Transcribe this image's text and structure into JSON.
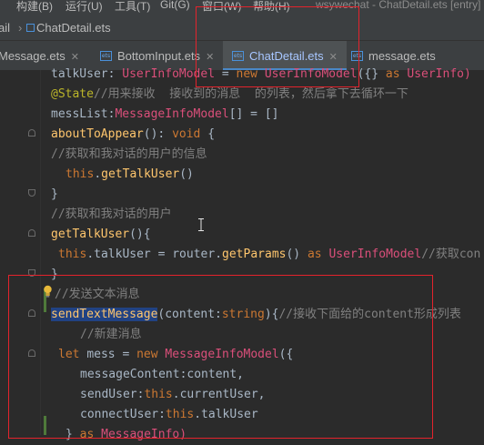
{
  "menubar": {
    "items": [
      "il",
      "构建(B)",
      "运行(U)",
      "工具(T)",
      "Git(G)",
      "窗口(W)",
      "帮助(H)"
    ],
    "window_title": "wsywechat - ChatDetail.ets [entry]"
  },
  "breadcrumb": {
    "prev": "ail",
    "file": "ChatDetail.ets"
  },
  "tabs": [
    {
      "label": "Message.ets",
      "active": false
    },
    {
      "label": "BottomInput.ets",
      "active": false
    },
    {
      "label": "ChatDetail.ets",
      "active": true
    },
    {
      "label": "message.ets",
      "active": false
    }
  ],
  "code": {
    "l1": {
      "a": "talkUser",
      "b": ": ",
      "c": "UserInfoModel",
      "d": " = ",
      "e": "new ",
      "f": "UserInfoModel",
      "g": "({} ",
      "h": "as ",
      "i": "UserInfo)"
    },
    "l2": {
      "a": "@State",
      "b": "//用来接收  接收到的消息  的列表，然后拿下去循环一下"
    },
    "l3": {
      "a": "messList",
      "b": ":",
      "c": "MessageInfoModel",
      "d": "[] = []"
    },
    "l4": {
      "a": "aboutToAppear",
      "b": "(): ",
      "c": "void",
      "d": " {"
    },
    "l5": {
      "a": "//获取和我对话的用户的信息"
    },
    "l6": {
      "a": "this",
      "b": ".",
      "c": "getTalkUser",
      "d": "()"
    },
    "l7": {
      "a": "}"
    },
    "l8": {
      "a": "//获取和我对话的用户"
    },
    "l9": {
      "a": "getTalkUser",
      "b": "(){"
    },
    "l10": {
      "a": "this",
      "b": ".talkUser = router.",
      "c": "getParams",
      "d": "() ",
      "e": "as ",
      "f": "UserInfoModel",
      "g": "//获取con"
    },
    "l11": {
      "a": "}"
    },
    "l12": {
      "a": "//发送文本消息"
    },
    "l13": {
      "a": "sendTextMessage",
      "b": "(content:",
      "c": "string",
      "d": "){",
      "e": "//接收下面给的content形成列表"
    },
    "l14": {
      "a": "//新建消息"
    },
    "l15": {
      "a": "let ",
      "b": "mess = ",
      "c": "new ",
      "d": "MessageInfoModel",
      "e": "({"
    },
    "l16": {
      "a": "messageContent:content,"
    },
    "l17": {
      "a": "sendUser:",
      "b": "this",
      "c": ".currentUser,"
    },
    "l18": {
      "a": "connectUser:",
      "b": "this",
      "c": ".talkUser"
    },
    "l19": {
      "a": "} ",
      "b": "as ",
      "c": "MessageInfo)"
    }
  },
  "colors": {
    "highlight_box": "#e3232c",
    "keyword": "#cc7832",
    "type": "#da4f7a",
    "function": "#ffc66d",
    "comment": "#808080"
  }
}
